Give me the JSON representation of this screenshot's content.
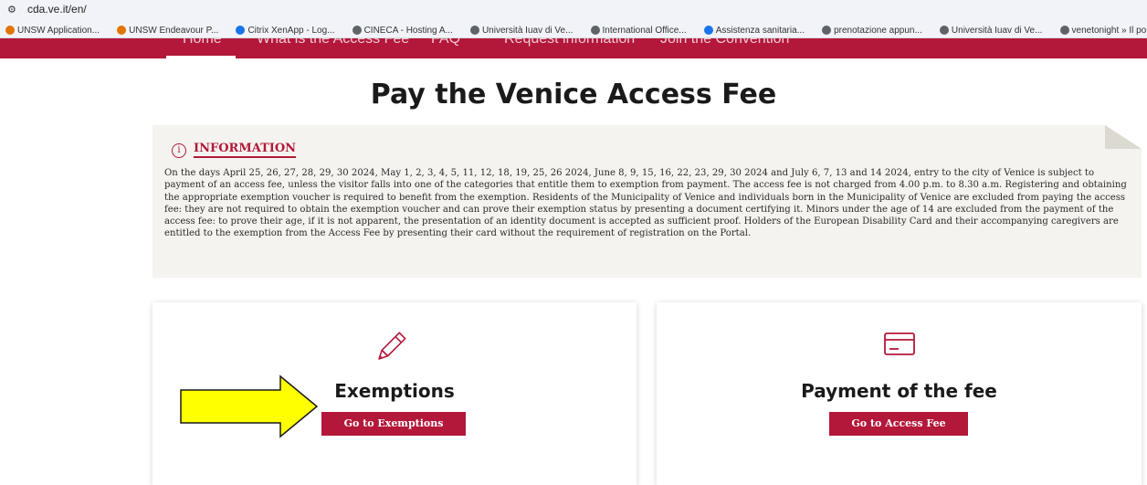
{
  "browser": {
    "url": "cda.ve.it/en/",
    "bookmarks": [
      {
        "label": "UNSW Application...",
        "color": "#e37400"
      },
      {
        "label": "UNSW Endeavour P...",
        "color": "#e37400"
      },
      {
        "label": "Citrix XenApp - Log...",
        "color": "#1a73e8"
      },
      {
        "label": "CINECA - Hosting A...",
        "color": "#5f6368"
      },
      {
        "label": "Università Iuav di Ve...",
        "color": "#5f6368"
      },
      {
        "label": "International Office...",
        "color": "#5f6368"
      },
      {
        "label": "Assistenza sanitaria...",
        "color": "#1a73e8"
      },
      {
        "label": "prenotazione appun...",
        "color": "#5f6368"
      },
      {
        "label": "Università Iuav di Ve...",
        "color": "#5f6368"
      },
      {
        "label": "venetonight » Il pon...",
        "color": "#5f6368"
      }
    ]
  },
  "nav": {
    "items": [
      "Home",
      "What is the Access Fee",
      "FAQ",
      "Request information",
      "Join the Convention"
    ]
  },
  "page": {
    "title": "Pay the Venice Access Fee"
  },
  "info": {
    "icon_glyph": "i",
    "heading": "INFORMATION",
    "text": "On the days April 25, 26, 27, 28, 29, 30 2024, May 1, 2, 3, 4, 5, 11, 12, 18, 19, 25, 26 2024, June 8, 9, 15, 16, 22, 23, 29, 30 2024 and July 6, 7, 13 and 14 2024, entry to the city of Venice is subject to payment of an access fee, unless the visitor falls into one of the categories that entitle them to exemption from payment. The access fee is not charged from 4.00 p.m. to 8.30 a.m. Registering and obtaining the appropriate exemption voucher is required to benefit from the exemption. Residents of the Municipality of Venice and individuals born in the Municipality of Venice are excluded from paying the access fee: they are not required to obtain the exemption voucher and can prove their exemption status by presenting a document certifying it. Minors under the age of 14 are excluded from the payment of the access fee: to prove their age, if it is not apparent, the presentation of an identity document is accepted as sufficient proof. Holders of the European Disability Card and their accompanying caregivers are entitled to the exemption from the Access Fee by presenting their card without the requirement of registration on the Portal."
  },
  "cards": [
    {
      "title": "Exemptions",
      "button": "Go to Exemptions",
      "icon": "pencil-icon"
    },
    {
      "title": "Payment of the fee",
      "button": "Go to Access Fee",
      "icon": "credit-card-icon"
    }
  ],
  "colors": {
    "brand": "#b3183a",
    "info_background": "#f4f3ef",
    "arrow_fill": "#ffff00"
  }
}
